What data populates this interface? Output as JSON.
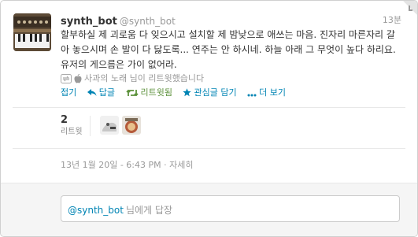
{
  "tweet": {
    "name": "synth_bot",
    "handle": "@synth_bot",
    "time": "13분",
    "text": "할부하실 제 괴로움 다 잊으시고 설치할 제 밤낮으로 애쓰는 마음. 진자리 마른자리 갈아 놓으시며 손 발이 다 닳도록... 연주는 안 하시네. 하늘 아래 그 무엇이 높다 하리요. 유저의 게으름은 가이 없어라.",
    "retweet_note": "사과의 노래 님이 리트윗했습니다",
    "datetime": "13년 1월 20일 - 6:43 PM · 자세히"
  },
  "actions": {
    "collapse": "접기",
    "reply": "답글",
    "retweeted": "리트윗됨",
    "favorite": "관심글 담기",
    "more": "더 보기"
  },
  "stats": {
    "retweet_count": "2",
    "retweet_label": "리트윗"
  },
  "reply": {
    "mention": "@synth_bot",
    "suffix": "님에게 답장"
  },
  "colors": {
    "link": "#0084b4",
    "retweeted": "#5c913b",
    "muted": "#999999"
  },
  "icons": [
    "corner-fold-icon",
    "retweet-icon",
    "apple-icon",
    "reply-icon",
    "retweeted-icon",
    "star-icon",
    "more-dots-icon"
  ]
}
